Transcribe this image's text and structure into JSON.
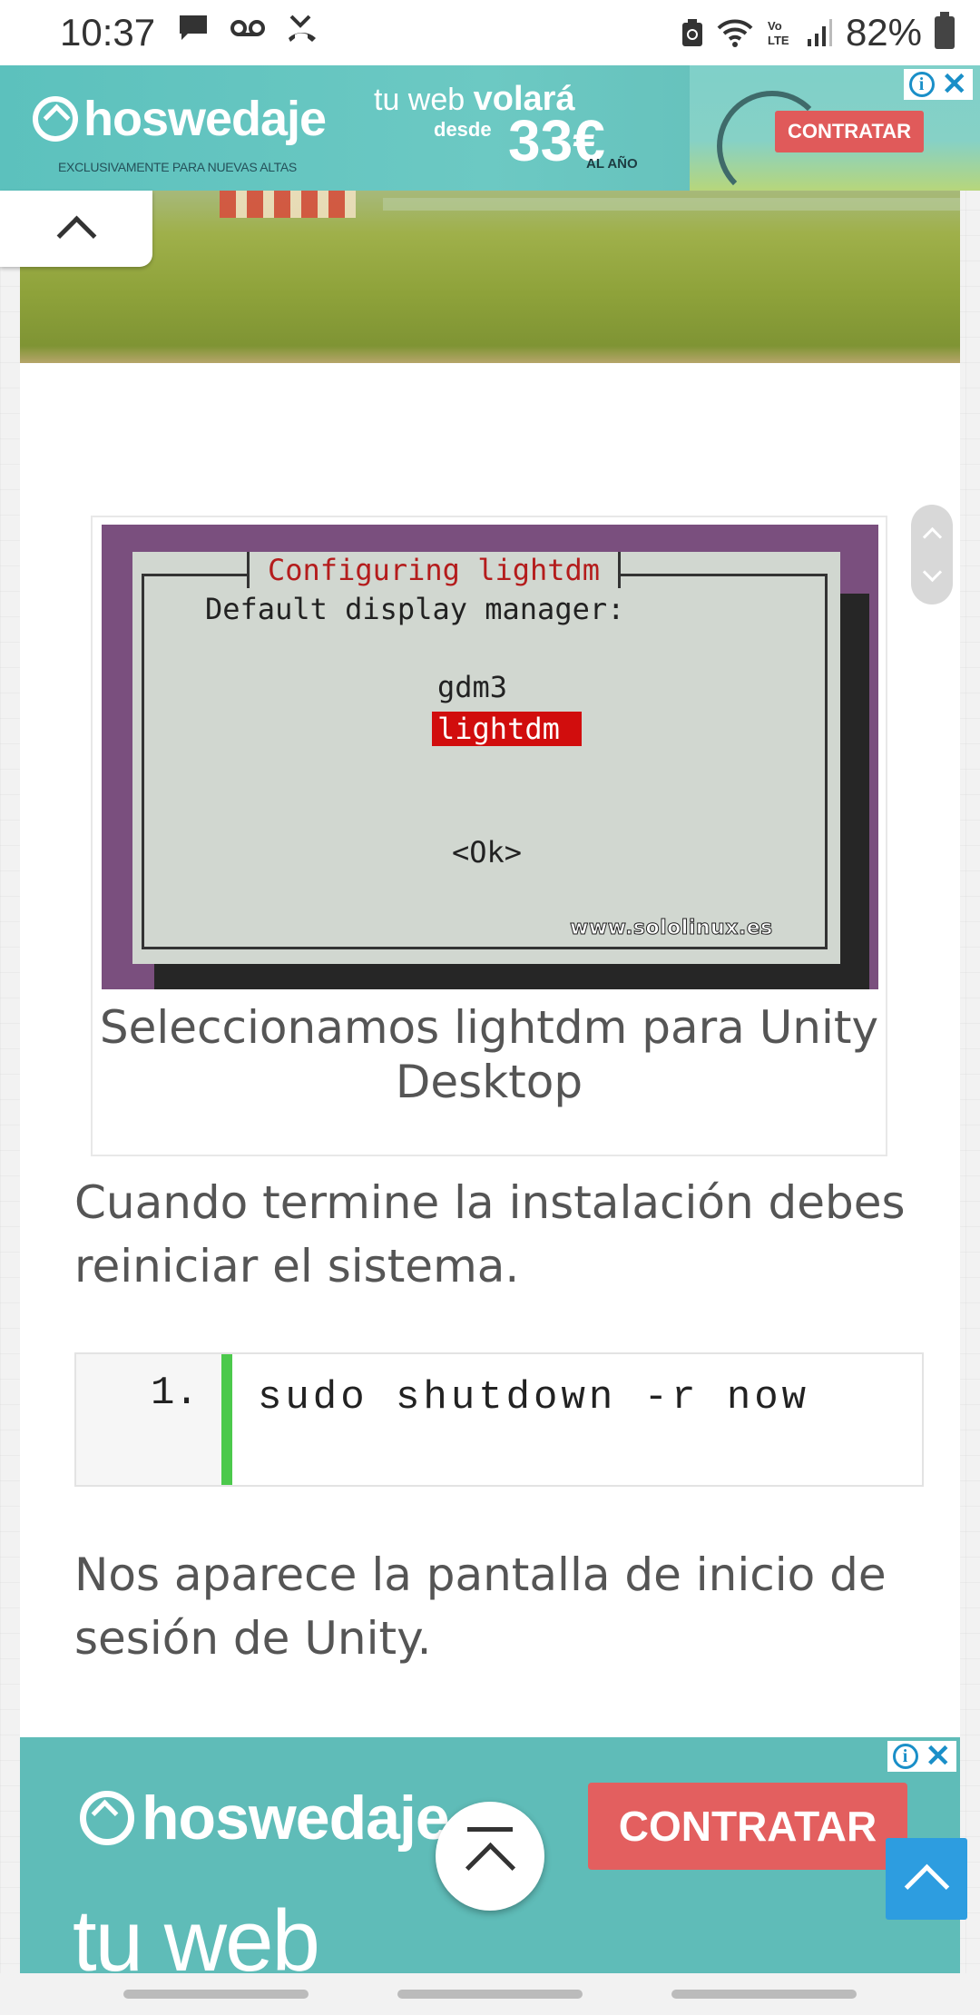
{
  "status_bar": {
    "time": "10:37",
    "left_icons": [
      "chat-icon",
      "voicemail-icon",
      "missed-call-icon"
    ],
    "right_icons": [
      "sync-icon",
      "wifi-icon",
      "volte-icon",
      "signal-icon"
    ],
    "battery_percent": "82%"
  },
  "ad_top": {
    "brand": "hoswedaje",
    "subtitle": "EXCLUSIVAMENTE PARA NUEVAS ALTAS",
    "tagline_prefix": "tu web",
    "tagline_bold": "volará",
    "from_label": "desde",
    "price": "33€",
    "per_year": "AL AÑO",
    "cta": "CONTRATAR"
  },
  "terminal": {
    "title": "Configuring lightdm",
    "prompt": "Default display manager:",
    "options": [
      "gdm3",
      "lightdm"
    ],
    "selected_option": "lightdm",
    "ok_button": "<Ok>",
    "watermark": "www.sololinux.es"
  },
  "figure_caption": "Seleccionamos lightdm para Unity Desktop",
  "paragraph_1": "Cuando termine la instalación debes reiniciar el sistema.",
  "code_block": {
    "line_number": "1.",
    "code": " sudo shutdown -r now"
  },
  "paragraph_2": "Nos aparece la pantalla de inicio de sesión de Unity.",
  "ad_bottom": {
    "brand": "hoswedaje",
    "cta": "CONTRATAR",
    "tagline": "tu web"
  },
  "ad_info_symbol": "i",
  "ad_close_symbol": "✕",
  "colors": {
    "ad_teal": "#5fbcb8",
    "cta_red": "#e05a5a",
    "terminal_purple": "#7a4f7e",
    "selection_red": "#d10d0d",
    "code_accent_green": "#4cc94c",
    "to_top_blue": "#2d9de0"
  }
}
